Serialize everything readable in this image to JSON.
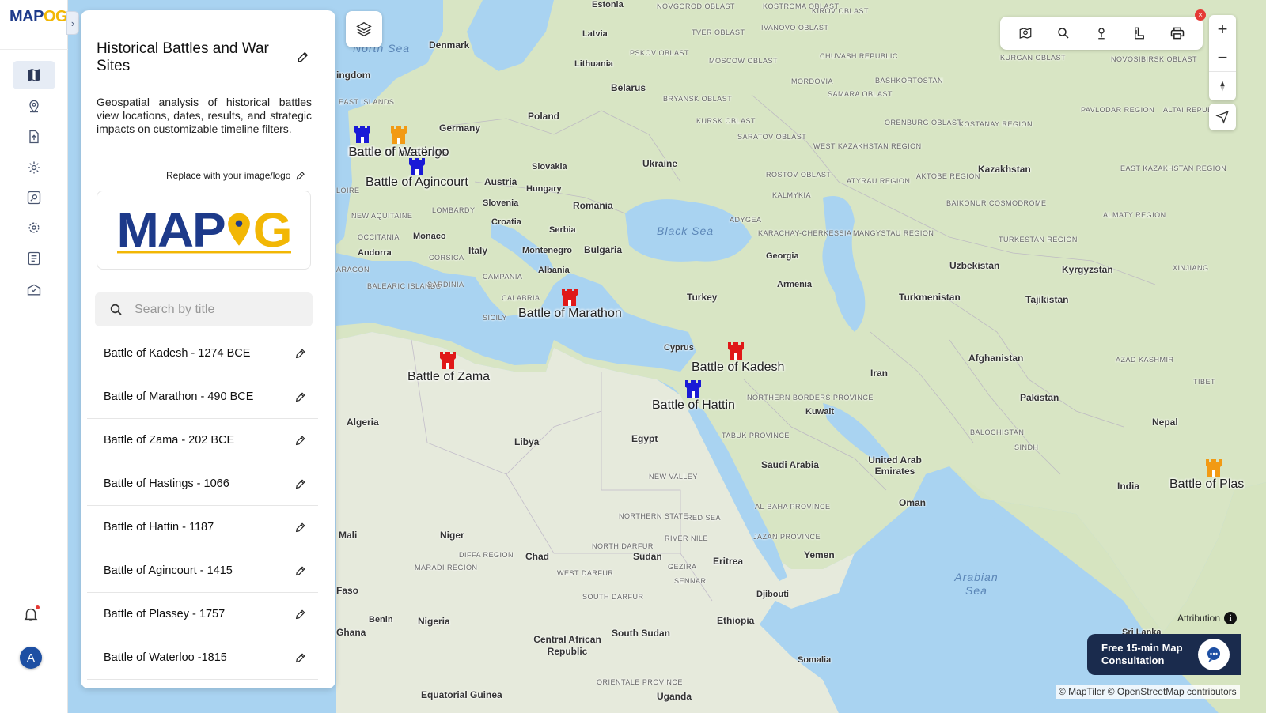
{
  "app": {
    "logo_main": "MAP",
    "logo_accent": "OG",
    "expand_glyph": "›",
    "avatar_initial": "A"
  },
  "rail": {
    "items": [
      {
        "name": "map-icon",
        "active": true
      },
      {
        "name": "location-pin-icon",
        "active": false
      },
      {
        "name": "file-upload-icon",
        "active": false
      },
      {
        "name": "settings-gear-icon",
        "active": false
      },
      {
        "name": "map-search-icon",
        "active": false
      },
      {
        "name": "cog-icon",
        "active": false
      },
      {
        "name": "report-icon",
        "active": false
      },
      {
        "name": "map-pin-check-icon",
        "active": false
      }
    ]
  },
  "panel": {
    "title": "Historical Battles and War Sites",
    "description": "Geospatial analysis of historical battles view locations, dates, results, and strategic impacts on customizable timeline filters.",
    "replace_logo_label": "Replace with your image/logo",
    "logo_text_main": "MAP",
    "logo_text_accent": "G",
    "search_placeholder": "Search by title",
    "items": [
      {
        "label": "Battle of Kadesh - 1274 BCE"
      },
      {
        "label": "Battle of Marathon - 490 BCE"
      },
      {
        "label": "Battle of Zama - 202 BCE"
      },
      {
        "label": "Battle of Hastings - 1066"
      },
      {
        "label": "Battle of Hattin - 1187"
      },
      {
        "label": "Battle of Agincourt - 1415"
      },
      {
        "label": "Battle of Plassey - 1757"
      },
      {
        "label": "Battle of Waterloo -1815"
      }
    ]
  },
  "map": {
    "markers": [
      {
        "label": "Battle of Hastings",
        "color": "#1a1ad6"
      },
      {
        "label": "Battle of Waterloo",
        "color": "#f29a14"
      },
      {
        "label": "Battle of Agincourt",
        "color": "#1a1ad6"
      },
      {
        "label": "Battle of Marathon",
        "color": "#e01818"
      },
      {
        "label": "Battle of Zama",
        "color": "#e01818"
      },
      {
        "label": "Battle of Kadesh",
        "color": "#e01818"
      },
      {
        "label": "Battle of Hattin",
        "color": "#1a1ad6"
      },
      {
        "label": "Battle of Plas",
        "color": "#f29a14"
      }
    ],
    "countries": [
      "Denmark",
      "Germany",
      "Poland",
      "Belarus",
      "Ukraine",
      "Latvia",
      "Lithuania",
      "Slovakia",
      "Hungary",
      "Austria",
      "Slovenia",
      "Croatia",
      "Romania",
      "Serbia",
      "Montenegro",
      "Bulgaria",
      "Italy",
      "Albania",
      "Monaco",
      "Andorra",
      "Turkey",
      "Georgia",
      "Armenia",
      "Cyprus",
      "Kazakhstan",
      "Uzbekistan",
      "Turkmenistan",
      "Kyrgyzstan",
      "Tajikistan",
      "Afghanistan",
      "Iran",
      "Pakistan",
      "Kuwait",
      "Saudi Arabia",
      "United Arab Emirates",
      "Oman",
      "Yemen",
      "Egypt",
      "Libya",
      "Algeria",
      "Niger",
      "Chad",
      "Sudan",
      "Mali",
      "Nigeria",
      "Eritrea",
      "Djibouti",
      "Ethiopia",
      "South Sudan",
      "Central African Republic",
      "Somalia",
      "Benin",
      "India",
      "Nepal",
      "Estonia",
      "Equatorial Guinea",
      "Uganda",
      "Sri Lanka",
      "Ghana",
      "Faso",
      "ingdom"
    ],
    "regions": [
      "NOVGOROD OBLAST",
      "KOSTROMA OBLAST",
      "KIROV OBLAST",
      "TVER OBLAST",
      "IVANOVO OBLAST",
      "PSKOV OBLAST",
      "MOSCOW OBLAST",
      "CHUVASH REPUBLIC",
      "MORDOVIA",
      "SAMARA OBLAST",
      "BASHKORTOSTAN",
      "BRYANSK OBLAST",
      "KURSK OBLAST",
      "ORENBURG OBLAST",
      "KOSTANAY REGION",
      "KURGAN OBLAST",
      "NOVOSIBIRSK OBLAST",
      "WEST KAZAKHSTAN REGION",
      "SARATOV OBLAST",
      "ROSTOV OBLAST",
      "KALMYKIA",
      "ATYRAU REGION",
      "AKTOBE REGION",
      "PAVLODAR REGION",
      "ALTAI REPUBLIC",
      "EAST KAZAKHSTAN REGION",
      "BAIKONUR COSMODROME",
      "ALMATY REGION",
      "ADYGEA",
      "KARACHAY-CHERKESSIA",
      "MANGYSTAU REGION",
      "TURKESTAN REGION",
      "XINJIANG",
      "AZAD KASHMIR",
      "TIBET",
      "BALOCHISTAN",
      "SINDH",
      "NORTHERN BORDERS PROVINCE",
      "TABUK PROVINCE",
      "RED SEA",
      "AL-BAHA PROVINCE",
      "JAZAN PROVINCE",
      "NORTHERN STATE",
      "NORTH DARFUR",
      "RIVER NILE",
      "WEST DARFUR",
      "SOUTH DARFUR",
      "GEZIRA",
      "SENNAR",
      "DIFFA REGION",
      "MARADI REGION",
      "ORIENTALE PROVINCE",
      "BALEARIC ISLANDS",
      "SARDINIA",
      "CAMPANIA",
      "CALABRIA",
      "SICILY",
      "CORSICA",
      "LOMBARDY",
      "OCCITANIA",
      "NEW AQUITAINE",
      "ARAGON",
      "LOIRE",
      "EAST ISLANDS",
      "NEW VALLEY"
    ],
    "seas": [
      "North Sea",
      "Black Sea",
      "Arabian Sea"
    ]
  },
  "toolbar": {
    "tools": [
      "map-search-icon",
      "search-icon",
      "person-pin-icon",
      "measure-icon",
      "print-icon"
    ],
    "close_glyph": "×",
    "zoom_in": "+",
    "zoom_out": "−"
  },
  "footer": {
    "attribution_label": "Attribution",
    "attribution_icon": "i",
    "consult_label": "Free 15-min Map Consultation",
    "copyright": "© MapTiler © OpenStreetMap contributors"
  }
}
